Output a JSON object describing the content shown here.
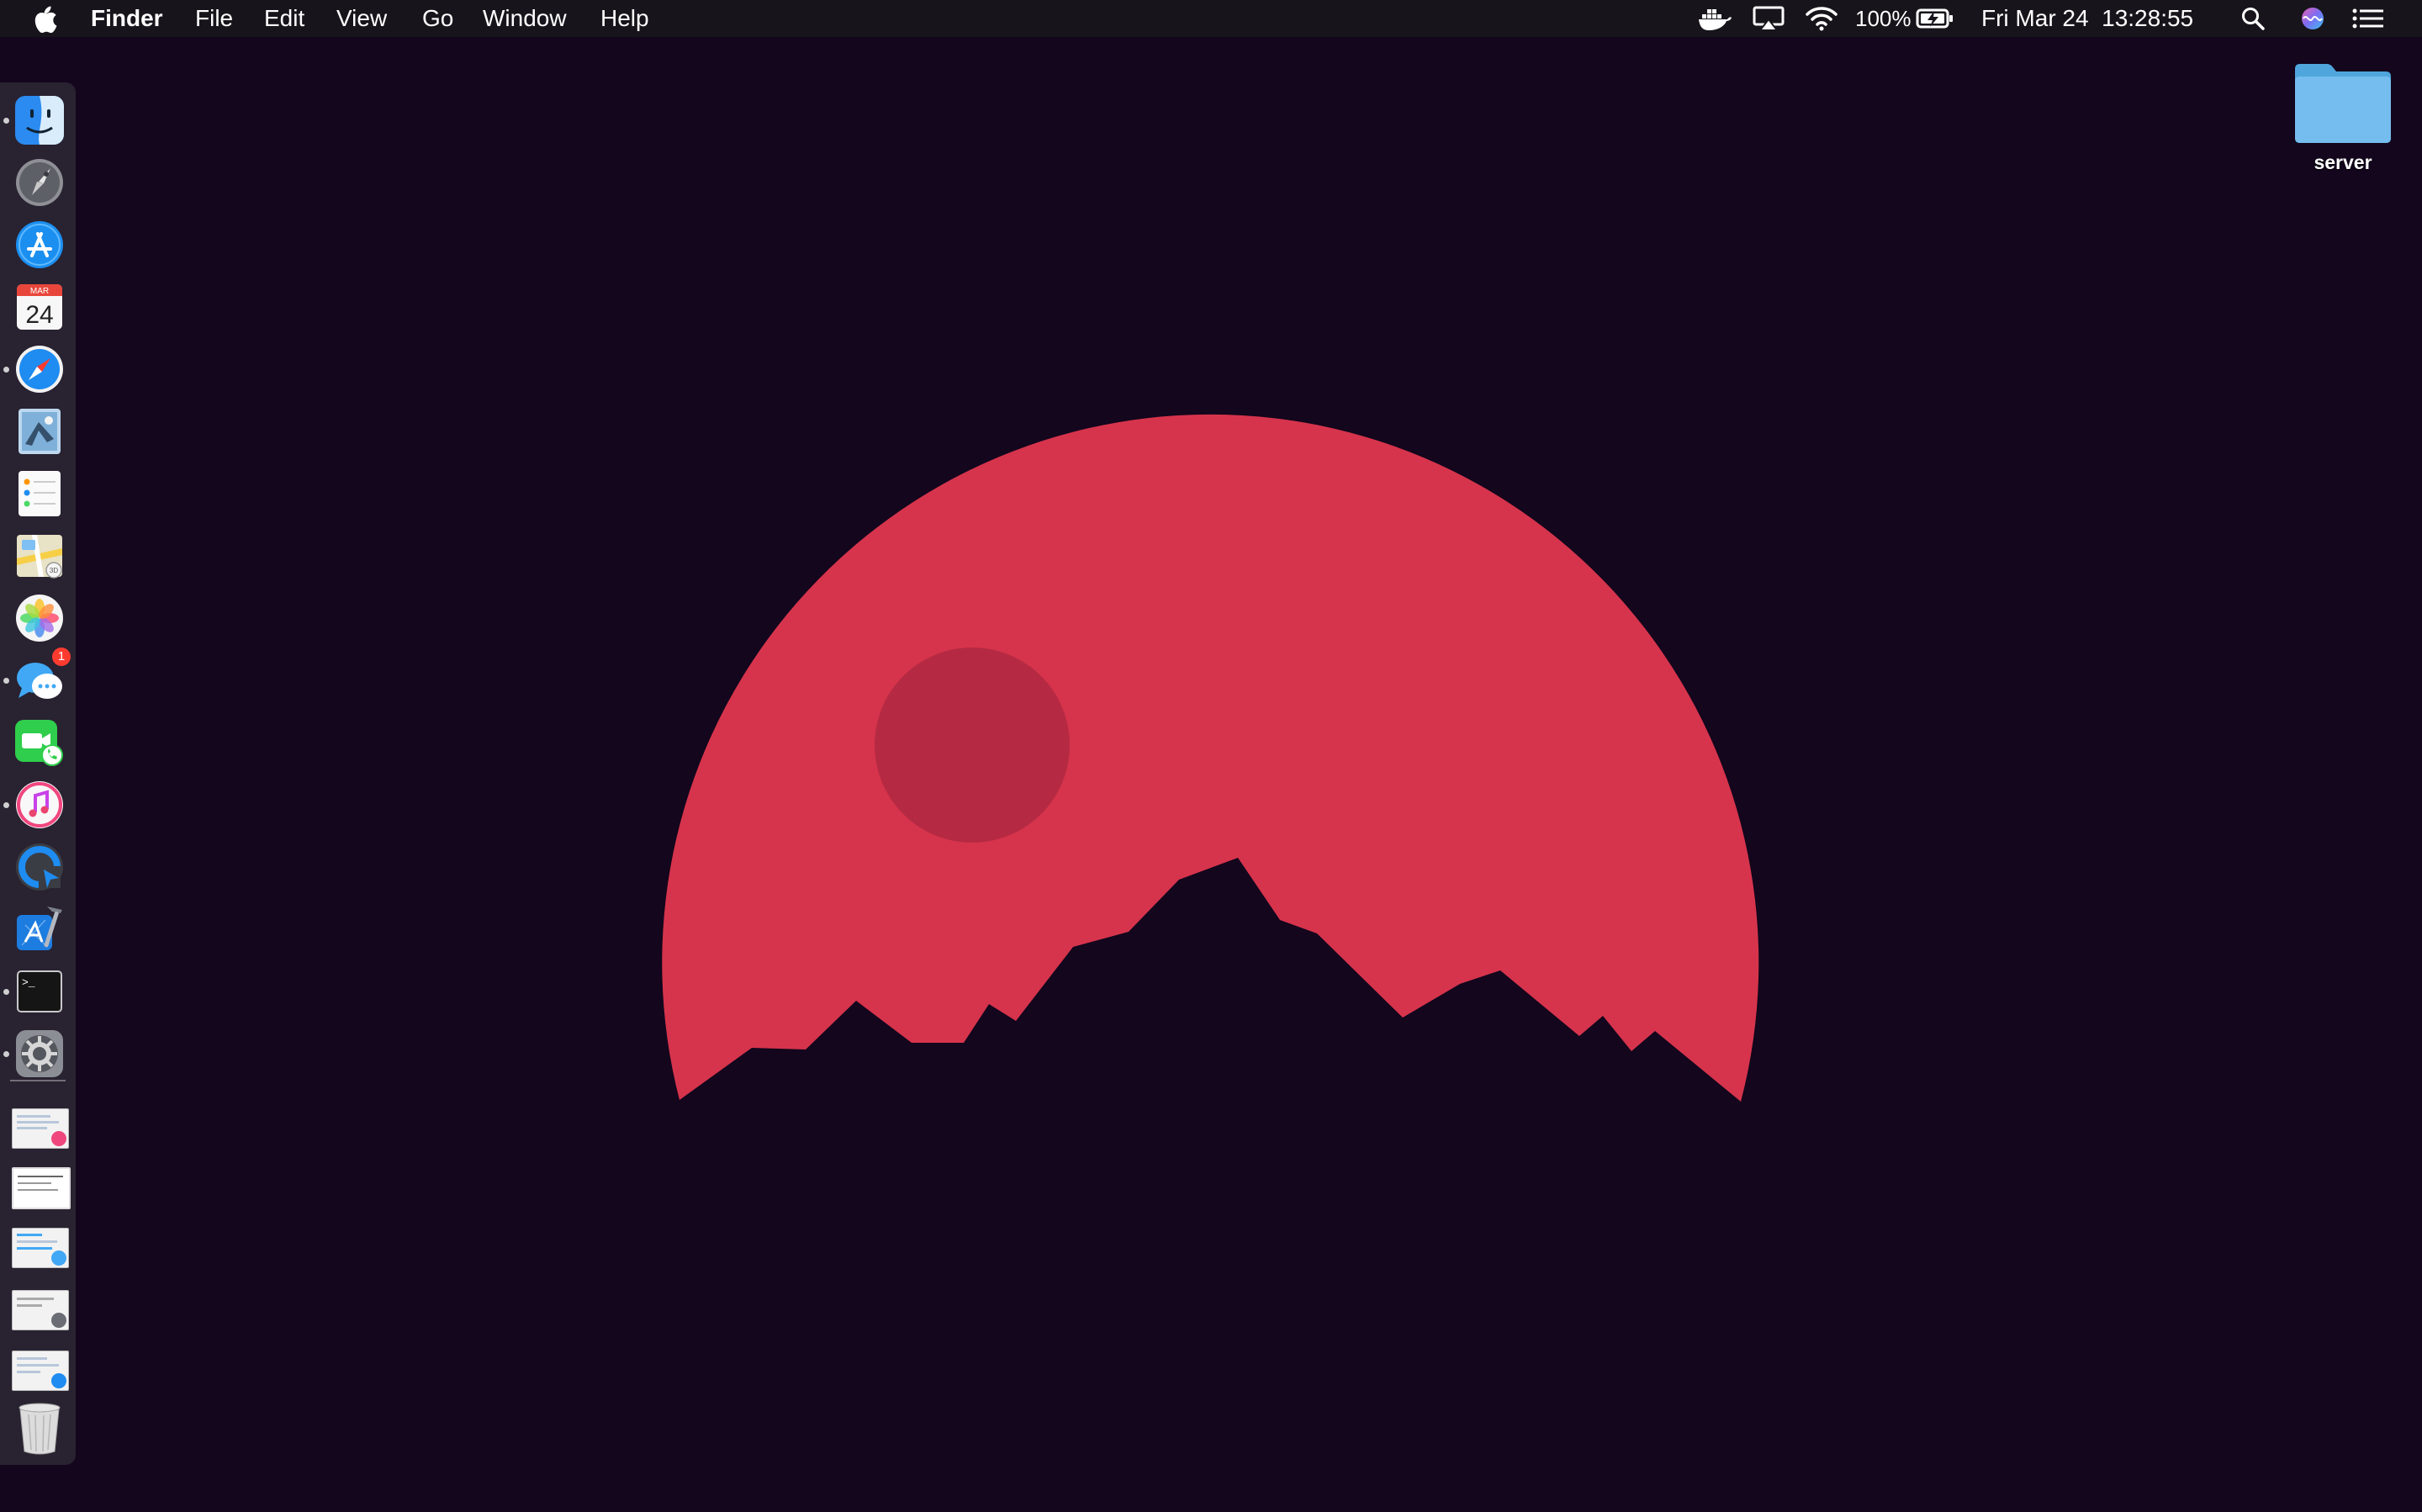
{
  "menubar": {
    "app_name": "Finder",
    "menus": [
      "File",
      "Edit",
      "View",
      "Go",
      "Window",
      "Help"
    ],
    "battery_percent": "100%",
    "datetime": "Fri Mar 24  13:28:55",
    "status_icons": [
      "docker-icon",
      "airplay-icon",
      "wifi-icon",
      "battery-charging-icon",
      "spotlight-icon",
      "siri-icon",
      "notification-center-icon"
    ]
  },
  "dock": {
    "apps": [
      {
        "name": "finder",
        "icon": "finder-icon",
        "running": true
      },
      {
        "name": "launchpad",
        "icon": "launchpad-icon",
        "running": false
      },
      {
        "name": "app-store",
        "icon": "app-store-icon",
        "running": false
      },
      {
        "name": "calendar",
        "icon": "calendar-icon",
        "running": false,
        "month": "MAR",
        "day": "24"
      },
      {
        "name": "safari",
        "icon": "safari-icon",
        "running": true
      },
      {
        "name": "mail",
        "icon": "mail-icon",
        "running": false
      },
      {
        "name": "reminders",
        "icon": "reminders-icon",
        "running": false
      },
      {
        "name": "maps",
        "icon": "maps-icon",
        "running": false
      },
      {
        "name": "photos",
        "icon": "photos-icon",
        "running": false
      },
      {
        "name": "messages",
        "icon": "messages-icon",
        "running": true,
        "badge": "1"
      },
      {
        "name": "facetime",
        "icon": "facetime-icon",
        "running": false
      },
      {
        "name": "itunes",
        "icon": "itunes-icon",
        "running": true
      },
      {
        "name": "screen-sharing",
        "icon": "screen-sharing-icon",
        "running": false
      },
      {
        "name": "xcode",
        "icon": "xcode-icon",
        "running": false
      },
      {
        "name": "terminal",
        "icon": "terminal-icon",
        "running": true,
        "prompt": ">_"
      },
      {
        "name": "system-preferences",
        "icon": "gear-icon",
        "running": true
      }
    ],
    "stack_items": [
      "document-thumbnail-itunes",
      "document-thumbnail-plain",
      "document-thumbnail-messages",
      "document-thumbnail-prefs",
      "document-thumbnail-safari"
    ],
    "trash_icon": "trash-icon"
  },
  "desktop": {
    "folder_label": "server",
    "folder_icon": "folder-icon"
  },
  "colors": {
    "background": "#13061d",
    "moon": "#d6344c",
    "crater": "#b52a42",
    "menubar": "#17151b",
    "folder": "#69b8ec"
  }
}
